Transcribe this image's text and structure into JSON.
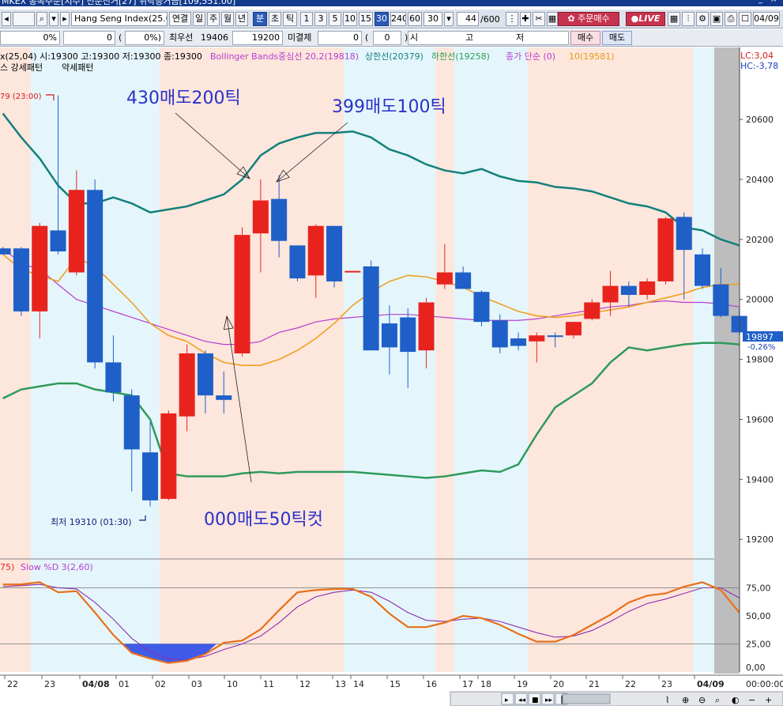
{
  "window": {
    "title": "MKEX  종목주문[지수]  전문선거[27]  위탁증거금[109,551.00]"
  },
  "toolbar": {
    "symbol": "Hang Seng Index(25.0",
    "tabs": [
      "연결",
      "일",
      "주",
      "월",
      "년",
      "분",
      "초",
      "틱"
    ],
    "tab_selected": "분",
    "intervals": [
      "1",
      "3",
      "5",
      "10",
      "15",
      "30",
      "240",
      "60"
    ],
    "interval_selected": "30",
    "interval_value": "30",
    "count_value": "44",
    "count_total": "/600",
    "order_button": "주문매수",
    "live_label": "LIVE",
    "date_value": "04/09"
  },
  "inforow": {
    "pct1": "0%",
    "v1": "0",
    "paren_open1": "(",
    "pct2": "0%)",
    "best_label": "최우선",
    "best_value": "19406",
    "best_value2": "19200",
    "unfilled_label": "미결제",
    "unfilled_value": "0",
    "paren_open2": "(",
    "unfilled_sub": "0",
    "paren_close2": ")",
    "si_label": "시",
    "go_label": "고",
    "jeo_label": "저",
    "buy_button": "매수",
    "sell_button": "매도"
  },
  "legend": {
    "ohlc": "x(25,04) 시:19300 고:19300 저:19300 종:19300",
    "bb_name": "Bollinger Bands중심선 20,2(19818)",
    "upper": "상한선(20379)",
    "lower": "하한선(19258)",
    "ma": "종가 단순 (0)",
    "ma10": "10(19581)",
    "pattern1": "스 강세패턴",
    "pattern2": "약세패턴",
    "lc": "LC:3,04",
    "hc": "HC:-3,78"
  },
  "annotations": {
    "high_marker": "79 (23:00)",
    "low_marker": "최저 19310 (01:30)",
    "sell1": "430매도200틱",
    "sell2": "399매도100틱",
    "sell3": "000매도50틱컷"
  },
  "price_box": {
    "value": "19897",
    "change": "-0,26%"
  },
  "stoch": {
    "label_prefix": "75)",
    "label": "Slow %D 3(2,60)"
  },
  "colors": {
    "up": "#e8231e",
    "down": "#1f5fc8",
    "bb_upper": "#13807c",
    "bb_lower": "#2e9a5a",
    "bb_mid": "#b53fd0",
    "ma": "#f0a020",
    "bg_pink": "#fde6dc",
    "bg_cyan": "#e4f6fb",
    "annotation": "#2a31c8"
  },
  "chart_data": {
    "type": "candlestick",
    "title": "Hang Seng Index(25.0",
    "interval": "30분",
    "y_ticks": [
      20600,
      20400,
      20200,
      20000,
      19800,
      19600,
      19400,
      19200
    ],
    "ylim": [
      19140,
      20840
    ],
    "x_ticks": [
      "22",
      "23",
      "04/08",
      "01",
      "02",
      "03",
      "10",
      "11",
      "12",
      "13",
      "14",
      "15",
      "16",
      "17",
      "18",
      "19",
      "20",
      "21",
      "22",
      "23",
      "04/09"
    ],
    "candles": [
      {
        "o": 20170,
        "h": 20175,
        "l": 20150,
        "c": 20150
      },
      {
        "o": 20170,
        "h": 20175,
        "l": 19945,
        "c": 19960
      },
      {
        "o": 19960,
        "h": 20255,
        "l": 19870,
        "c": 20245
      },
      {
        "o": 20230,
        "h": 20680,
        "l": 20150,
        "c": 20160
      },
      {
        "o": 20090,
        "h": 20430,
        "l": 20080,
        "c": 20365
      },
      {
        "o": 20365,
        "h": 20400,
        "l": 19770,
        "c": 19790
      },
      {
        "o": 19790,
        "h": 19880,
        "l": 19660,
        "c": 19690
      },
      {
        "o": 19680,
        "h": 19700,
        "l": 19360,
        "c": 19500
      },
      {
        "o": 19490,
        "h": 19590,
        "l": 19310,
        "c": 19330
      },
      {
        "o": 19335,
        "h": 19630,
        "l": 19330,
        "c": 19620
      },
      {
        "o": 19610,
        "h": 19850,
        "l": 19560,
        "c": 19820
      },
      {
        "o": 19820,
        "h": 19830,
        "l": 19620,
        "c": 19680
      },
      {
        "o": 19680,
        "h": 19760,
        "l": 19620,
        "c": 19665
      },
      {
        "o": 19820,
        "h": 20240,
        "l": 19810,
        "c": 20215
      },
      {
        "o": 20220,
        "h": 20400,
        "l": 20090,
        "c": 20330
      },
      {
        "o": 20335,
        "h": 20415,
        "l": 20140,
        "c": 20195
      },
      {
        "o": 20180,
        "h": 20180,
        "l": 20060,
        "c": 20070
      },
      {
        "o": 20080,
        "h": 20250,
        "l": 20005,
        "c": 20245
      },
      {
        "o": 20245,
        "h": 20245,
        "l": 20040,
        "c": 20060
      },
      {
        "o": 20095,
        "h": 20095,
        "l": 20095,
        "c": 20095
      },
      {
        "o": 20110,
        "h": 20130,
        "l": 19830,
        "c": 19830
      },
      {
        "o": 19920,
        "h": 19980,
        "l": 19750,
        "c": 19840
      },
      {
        "o": 19940,
        "h": 19970,
        "l": 19705,
        "c": 19825
      },
      {
        "o": 19830,
        "h": 20005,
        "l": 19770,
        "c": 19990
      },
      {
        "o": 20050,
        "h": 20185,
        "l": 20035,
        "c": 20090
      },
      {
        "o": 20090,
        "h": 20110,
        "l": 20040,
        "c": 20035
      },
      {
        "o": 20025,
        "h": 20030,
        "l": 19910,
        "c": 19925
      },
      {
        "o": 19930,
        "h": 19950,
        "l": 19820,
        "c": 19840
      },
      {
        "o": 19870,
        "h": 19890,
        "l": 19830,
        "c": 19845
      },
      {
        "o": 19860,
        "h": 19890,
        "l": 19790,
        "c": 19880
      },
      {
        "o": 19880,
        "h": 19890,
        "l": 19840,
        "c": 19875
      },
      {
        "o": 19880,
        "h": 19920,
        "l": 19870,
        "c": 19925
      },
      {
        "o": 19935,
        "h": 20000,
        "l": 19930,
        "c": 19990
      },
      {
        "o": 19990,
        "h": 20095,
        "l": 19945,
        "c": 20045
      },
      {
        "o": 20045,
        "h": 20060,
        "l": 19975,
        "c": 20015
      },
      {
        "o": 20015,
        "h": 20070,
        "l": 20000,
        "c": 20060
      },
      {
        "o": 20060,
        "h": 20275,
        "l": 20050,
        "c": 20270
      },
      {
        "o": 20275,
        "h": 20290,
        "l": 20000,
        "c": 20165
      },
      {
        "o": 20150,
        "h": 20170,
        "l": 20035,
        "c": 20045
      },
      {
        "o": 20050,
        "h": 20105,
        "l": 19940,
        "c": 19945
      },
      {
        "o": 19945,
        "h": 19970,
        "l": 19880,
        "c": 19890
      }
    ],
    "bb_upper": [
      20620,
      20540,
      20470,
      20380,
      20320,
      20320,
      20340,
      20320,
      20290,
      20300,
      20310,
      20330,
      20350,
      20400,
      20480,
      20520,
      20540,
      20555,
      20555,
      20560,
      20540,
      20500,
      20480,
      20450,
      20430,
      20420,
      20435,
      20410,
      20395,
      20390,
      20375,
      20370,
      20360,
      20340,
      20320,
      20310,
      20290,
      20240,
      20230,
      20200,
      20180
    ],
    "bb_mid": [
      20170,
      20120,
      20100,
      20050,
      20000,
      19980,
      19960,
      19940,
      19920,
      19900,
      19880,
      19860,
      19850,
      19850,
      19860,
      19890,
      19905,
      19925,
      19935,
      19940,
      19945,
      19950,
      19950,
      19945,
      19940,
      19935,
      19930,
      19930,
      19930,
      19935,
      19945,
      19955,
      19965,
      19975,
      19980,
      19990,
      19995,
      19990,
      19990,
      19985,
      19975
    ],
    "bb_lower": [
      19670,
      19700,
      19710,
      19720,
      19720,
      19700,
      19690,
      19680,
      19600,
      19420,
      19410,
      19410,
      19410,
      19420,
      19425,
      19420,
      19425,
      19425,
      19425,
      19425,
      19420,
      19415,
      19410,
      19405,
      19410,
      19420,
      19430,
      19425,
      19450,
      19550,
      19640,
      19680,
      19720,
      19790,
      19840,
      19830,
      19840,
      19850,
      19855,
      19855,
      19850
    ],
    "ma10": [
      20150,
      20100,
      20080,
      20060,
      20140,
      20110,
      20050,
      19990,
      19920,
      19880,
      19860,
      19820,
      19790,
      19780,
      19780,
      19800,
      19830,
      19870,
      19920,
      19980,
      20025,
      20060,
      20080,
      20075,
      20060,
      20040,
      20010,
      19985,
      19960,
      19945,
      19940,
      19945,
      19955,
      19965,
      19975,
      19990,
      20005,
      20020,
      20040,
      20050,
      20050
    ],
    "stoch_k": [
      78,
      78,
      80,
      71,
      72,
      53,
      33,
      17,
      12,
      8,
      10,
      16,
      26,
      28,
      38,
      55,
      71,
      73,
      74,
      74,
      67,
      52,
      40,
      40,
      44,
      50,
      48,
      42,
      34,
      27,
      27,
      33,
      42,
      51,
      62,
      68,
      70,
      76,
      80,
      73,
      53
    ],
    "stoch_d": [
      76,
      77,
      78,
      75,
      74,
      62,
      47,
      30,
      18,
      12,
      11,
      14,
      20,
      25,
      32,
      44,
      58,
      67,
      71,
      73,
      71,
      63,
      53,
      46,
      45,
      47,
      48,
      45,
      40,
      35,
      31,
      32,
      37,
      45,
      54,
      61,
      65,
      70,
      75,
      75,
      66
    ],
    "stoch_ylim": [
      0,
      100
    ],
    "stoch_ticks": [
      "75,00",
      "50,00",
      "25,00",
      "0,00"
    ],
    "bottom_right_label": "00:00:00",
    "backgrounds": [
      "pink",
      "pink",
      "cyan",
      "cyan",
      "cyan",
      "cyan",
      "cyan",
      "cyan",
      "cyan",
      "pink",
      "pink",
      "pink",
      "pink",
      "pink",
      "pink",
      "pink",
      "pink",
      "pink",
      "pink",
      "cyan",
      "cyan",
      "cyan",
      "cyan",
      "cyan",
      "pink",
      "cyan",
      "cyan",
      "cyan",
      "cyan",
      "pink",
      "pink",
      "pink",
      "pink",
      "pink",
      "pink",
      "pink",
      "pink",
      "pink",
      "cyan",
      "cyan",
      "cyan"
    ]
  }
}
